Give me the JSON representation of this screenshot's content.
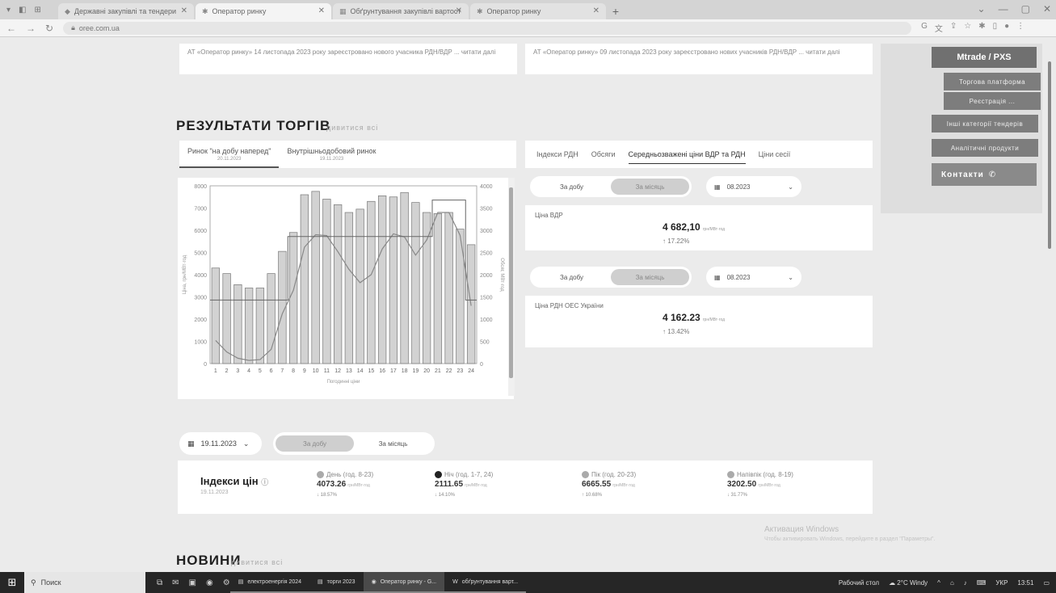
{
  "browser": {
    "tabs": [
      {
        "label": "Державні закупівлі та тендери",
        "active": false
      },
      {
        "label": "Оператор ринку",
        "active": true
      },
      {
        "label": "Обґрунтування закупівлі вартост",
        "active": false
      },
      {
        "label": "Оператор ринку",
        "active": false
      }
    ],
    "url": "oree.com.ua"
  },
  "news_top": [
    {
      "text": "АТ «Оператор ринку» 14 листопада 2023 року зареєстровано нового учасника РДН/ВДР ... читати далі"
    },
    {
      "text": "АТ «Оператор ринку» 09 листопада 2023 року зареєстровано нових учасників РДН/ВДР ... читати далі"
    }
  ],
  "sidebar": {
    "logo": "Mtrade / PXS",
    "buttons": [
      "Торгова платформа",
      "Реєстрація ..."
    ],
    "wide_buttons": [
      "Інші категорії тендерів",
      "Аналітичні продукти"
    ],
    "contacts": "Контакти"
  },
  "results": {
    "title": "РЕЗУЛЬТАТИ ТОРГІВ",
    "see_all": "дивитися всі",
    "market_tabs": [
      {
        "label": "Ринок \"на добу наперед\"",
        "sub": "20.11.2023",
        "active": true
      },
      {
        "label": "Внутрішньодобовий ринок",
        "sub": "19.11.2023",
        "active": false
      }
    ],
    "index_tabs": [
      {
        "label": "Індекси РДН",
        "active": false
      },
      {
        "label": "Обсяги",
        "active": false
      },
      {
        "label": "Середньозважені ціни ВДР та РДН",
        "active": true
      },
      {
        "label": "Ціни сесії",
        "active": false
      }
    ]
  },
  "chart_data": {
    "type": "bar",
    "categories": [
      "1",
      "2",
      "3",
      "4",
      "5",
      "6",
      "7",
      "8",
      "9",
      "10",
      "11",
      "12",
      "13",
      "14",
      "15",
      "16",
      "17",
      "18",
      "19",
      "20",
      "21",
      "22",
      "23",
      "24"
    ],
    "series": [
      {
        "name": "",
        "values": [
          4300,
          4050,
          3550,
          3400,
          3400,
          4050,
          5050,
          5900,
          7600,
          7750,
          7400,
          7150,
          6800,
          6950,
          7300,
          7550,
          7500,
          7700,
          7250,
          6800,
          6750,
          6800,
          6050,
          5350
        ],
        "axis": "left"
      },
      {
        "name": "",
        "values": [
          520,
          260,
          120,
          70,
          90,
          320,
          1120,
          1650,
          2620,
          2900,
          2880,
          2520,
          2120,
          1820,
          2000,
          2580,
          2920,
          2850,
          2440,
          2780,
          3400,
          3400,
          2890,
          1300
        ],
        "axis": "right"
      },
      {
        "name": "",
        "values": [
          1430,
          1430,
          1430,
          1430,
          1430,
          1430,
          1430,
          2860,
          2860,
          2860,
          2860,
          2860,
          2860,
          2860,
          2860,
          2860,
          2860,
          2860,
          2860,
          2860,
          3680,
          3680,
          3680,
          1430
        ],
        "axis": "right"
      }
    ],
    "xlabel": "Погодинні ціни",
    "ylabel": "Ціна, грн/МВт·год",
    "y2label": "Обсяг, МВт·год",
    "ylim": [
      0,
      8000
    ],
    "y2lim": [
      0,
      4000
    ],
    "yticks": [
      0,
      1000,
      2000,
      3000,
      4000,
      5000,
      6000,
      7000,
      8000
    ],
    "y2ticks": [
      0,
      500,
      1000,
      1500,
      2000,
      2500,
      3000,
      3500,
      4000
    ]
  },
  "price_blocks": [
    {
      "toggle": [
        "За добу",
        "За місяць"
      ],
      "selected": 1,
      "date": "08.2023",
      "label": "Ціна ВДР",
      "value": "4 682,10",
      "unit": "грн/МВт·год",
      "change": "↑ 17.22%"
    },
    {
      "toggle": [
        "За добу",
        "За місяць"
      ],
      "selected": 1,
      "date": "08.2023",
      "label": "Ціна РДН ОЕС України",
      "value": "4 162.23",
      "unit": "грн/МВт·год",
      "change": "↑ 13.42%"
    }
  ],
  "indexes": {
    "date": "19.11.2023",
    "toggle": [
      "За добу",
      "За місяць"
    ],
    "selected": 0,
    "title": "Індекси цін",
    "title_date": "19.11.2023",
    "cols": [
      {
        "label": "День (год. 8-23)",
        "value": "4073.26",
        "unit": "грн/МВт·год",
        "change": "↓ 18.57%",
        "icon": "sun-icon"
      },
      {
        "label": "Ніч (год. 1-7, 24)",
        "value": "2111.65",
        "unit": "грн/МВт·год",
        "change": "↓ 14.10%",
        "icon": "moon-icon"
      },
      {
        "label": "Пік (год. 20-23)",
        "value": "6665.55",
        "unit": "грн/МВт·год",
        "change": "↑ 10.68%",
        "icon": "peak-icon"
      },
      {
        "label": "Напівпік (год. 8-19)",
        "value": "3202.50",
        "unit": "грн/МВт·год",
        "change": "↓ 31.77%",
        "icon": "half-peak-icon"
      }
    ]
  },
  "news": {
    "title": "НОВИНИ",
    "see_all": "дивитися всі"
  },
  "activation": {
    "title": "Активация Windows",
    "text": "Чтобы активировать Windows, перейдите в раздел \"Параметры\"."
  },
  "taskbar": {
    "search": "Поиск",
    "apps": [
      "електроенергія 2024",
      "торги 2023",
      "Оператор ринку - G...",
      "обґрунтування варт..."
    ],
    "desktop": "Рабочий стол",
    "weather": "2°C Windy",
    "lang": "УКР",
    "time": "13:51"
  }
}
